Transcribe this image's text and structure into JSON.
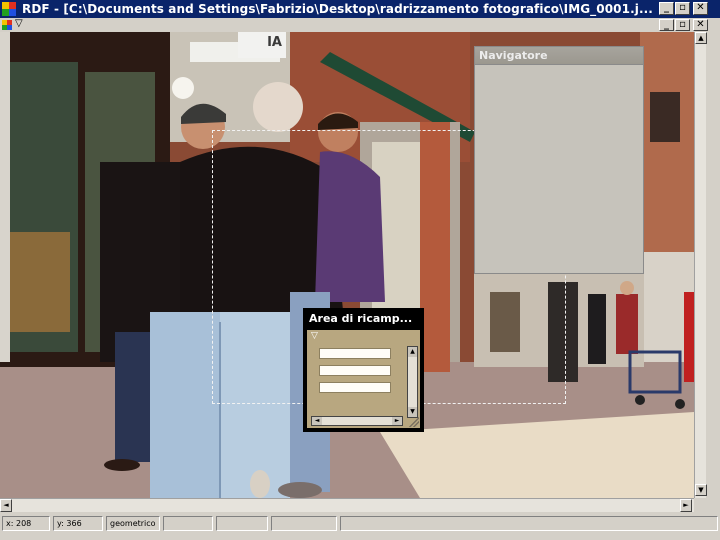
{
  "window": {
    "title": "RDF - [C:\\Documents and Settings\\Fabrizio\\Desktop\\radrizzamento fotografico\\IMG_0001.j...",
    "min_glyph": "_",
    "restore_glyph": "▫",
    "close_glyph": "✕",
    "menu_chevron": "▽"
  },
  "colors": {
    "titlebar": "#0a246a",
    "chrome": "#d4d0c8",
    "navigator_bg": "#c6c3bb",
    "resample_bg": "#b8a780"
  },
  "navigator": {
    "title": "Navigatore"
  },
  "resample_panel": {
    "title": "Area di ricamp...",
    "chevron": "▽",
    "items": [
      "",
      "",
      ""
    ]
  },
  "scroll": {
    "up": "▲",
    "down": "▼",
    "left": "◄",
    "right": "►"
  },
  "status": {
    "x_readout": "x: 208",
    "y_readout": "y: 366",
    "mode": "geometrico",
    "cell4": "",
    "cell5": "",
    "cell6": ""
  },
  "photo": {
    "shop_sign": "IA"
  }
}
